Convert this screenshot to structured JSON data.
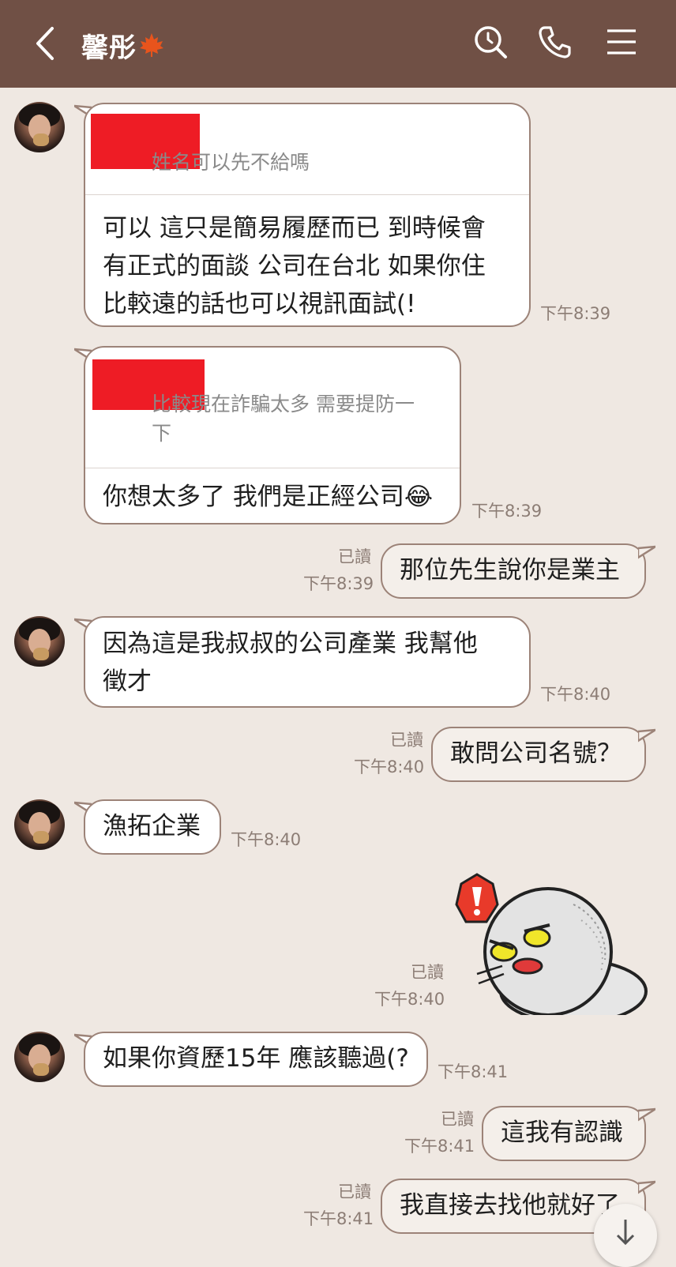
{
  "header": {
    "title": "馨彤",
    "icons": [
      "back-icon",
      "search-icon",
      "phone-icon",
      "menu-icon"
    ]
  },
  "messages": [
    {
      "from": "them",
      "reply_quote": "姓名可以先不給嗎",
      "lines": [
        "可以 這只是簡易履歷而已 到時候會",
        "有正式的面談 公司在台北 如果你住",
        "比較遠的話也可以視訊面試(!"
      ],
      "time": "下午8:39"
    },
    {
      "from": "them",
      "reply_quote_lines": [
        "比較現在詐騙太多  需要提防一",
        "下"
      ],
      "text": "你想太多了 我們是正經公司😂",
      "time": "下午8:39"
    },
    {
      "from": "me",
      "read": "已讀",
      "text": "那位先生說你是業主",
      "time": "下午8:39"
    },
    {
      "from": "them",
      "lines": [
        "因為這是我叔叔的公司產業 我幫他",
        "徵才"
      ],
      "time": "下午8:40"
    },
    {
      "from": "me",
      "read": "已讀",
      "text": "敢問公司名號？",
      "time": "下午8:40"
    },
    {
      "from": "them",
      "text": "漁拓企業",
      "time": "下午8:40"
    },
    {
      "from": "me",
      "read": "已讀",
      "sticker": "angry-moon-sticker",
      "time": "下午8:40"
    },
    {
      "from": "them",
      "text": "如果你資歷15年 應該聽過(?",
      "time": "下午8:41"
    },
    {
      "from": "me",
      "read": "已讀",
      "text": "這我有認識",
      "time": "下午8:41"
    },
    {
      "from": "me",
      "read": "已讀",
      "text": "我直接去找他就好了",
      "time": "下午8:41"
    }
  ],
  "colors": {
    "header_bg": "#705045",
    "chat_bg": "#efe8e2",
    "bubble_border": "#9c8378",
    "redaction": "#ee1c25"
  }
}
